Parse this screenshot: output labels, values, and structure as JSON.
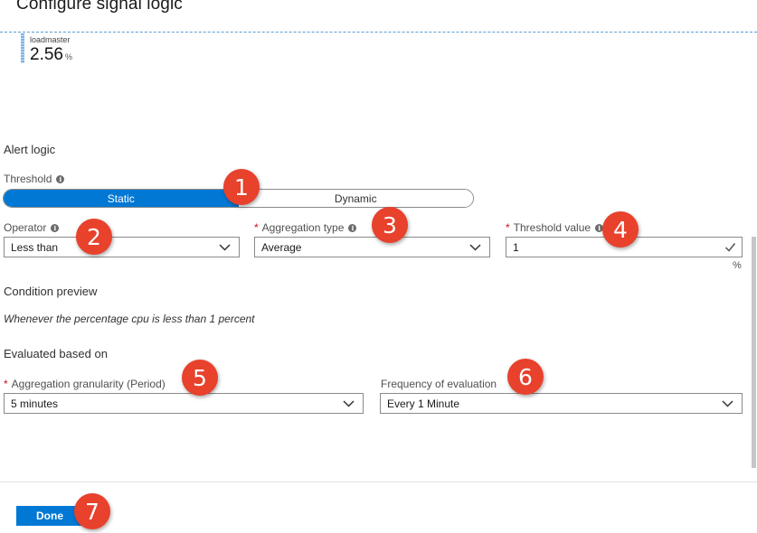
{
  "blade": {
    "title": "Configure signal logic"
  },
  "metric": {
    "name": "loadmaster",
    "value": "2.56",
    "unit": "%"
  },
  "alert_logic": {
    "title": "Alert logic",
    "threshold_label": "Threshold",
    "threshold_options": [
      "Static",
      "Dynamic"
    ],
    "threshold_selected": "Static",
    "operator": {
      "label": "Operator",
      "value": "Less than"
    },
    "aggregation_type": {
      "required": "*",
      "label": "Aggregation type",
      "value": "Average"
    },
    "threshold_value": {
      "required": "*",
      "label": "Threshold value",
      "value": "1",
      "unit": "%"
    }
  },
  "condition_preview": {
    "title": "Condition preview",
    "text": "Whenever the percentage cpu is less than 1 percent"
  },
  "evaluation": {
    "title": "Evaluated based on",
    "granularity": {
      "required": "*",
      "label": "Aggregation granularity (Period)",
      "value": "5 minutes"
    },
    "frequency": {
      "label": "Frequency of evaluation",
      "value": "Every 1 Minute"
    }
  },
  "footer": {
    "done_label": "Done"
  },
  "annotations": [
    "1",
    "2",
    "3",
    "4",
    "5",
    "6",
    "7"
  ],
  "colors": {
    "accent": "#0078d4",
    "annotation": "#e8412c",
    "required": "#c50f1f"
  }
}
